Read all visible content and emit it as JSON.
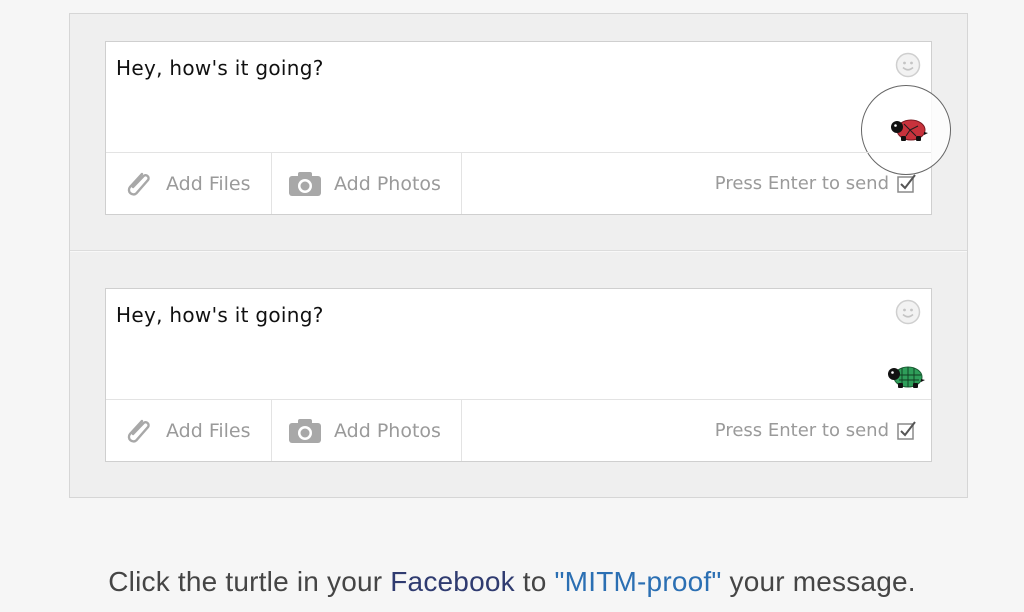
{
  "composers": [
    {
      "message": "Hey, how's it going?",
      "add_files": "Add Files",
      "add_photos": "Add Photos",
      "enter_to_send": "Press Enter to send",
      "turtle_state": "red-unverified",
      "highlighted": true
    },
    {
      "message": "Hey, how's it going?",
      "add_files": "Add Files",
      "add_photos": "Add Photos",
      "enter_to_send": "Press Enter to send",
      "turtle_state": "green-verified",
      "highlighted": false
    }
  ],
  "caption": {
    "part1": "Click the turtle in your ",
    "facebook": "Facebook",
    "part2": " to ",
    "mitm": "\"MITM-proof\"",
    "part3": " your message."
  },
  "colors": {
    "turtle_red": "#c8323c",
    "turtle_green": "#2f9e5a",
    "facebook_link": "#2f3b70",
    "mitm_link": "#2b6fb3"
  },
  "icons": [
    "smiley-icon",
    "paperclip-icon",
    "camera-icon",
    "checkbox-icon",
    "turtle-icon"
  ]
}
